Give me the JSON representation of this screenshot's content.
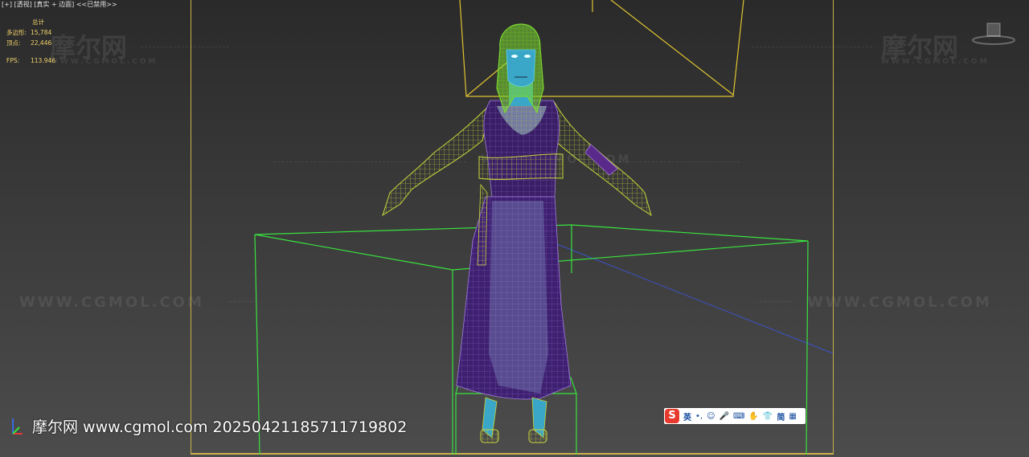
{
  "viewport": {
    "label": "[+] [透视] [真实 + 边面] <<已禁用>>"
  },
  "stats": {
    "header": "总计",
    "polygons_label": "多边形:",
    "polygons_value": "15,784",
    "vertices_label": "顶点:",
    "vertices_value": "22,446",
    "fps_label": "FPS:",
    "fps_value": "113.946"
  },
  "watermarks": {
    "brand": "摩尔网",
    "url": "WWW.CGMOL.COM"
  },
  "caption": "摩尔网 www.cgmol.com 20250421185711719802",
  "ime_toolbar": {
    "logo": "S",
    "mode": "英",
    "punct": "•,",
    "emoji_icon": "☺",
    "voice_icon": "🎤",
    "keyboard_icon": "⌨",
    "tools_icon": "✋",
    "skin_icon": "👕",
    "script": "简",
    "menu_icon": "▦"
  },
  "colors": {
    "frame": "#c9b24a",
    "light_box": "#39e33f",
    "camera": "#e0c431",
    "head_wire": "#7cd832",
    "robe": "#4a2a7a",
    "skin": "#3aa6c8"
  }
}
